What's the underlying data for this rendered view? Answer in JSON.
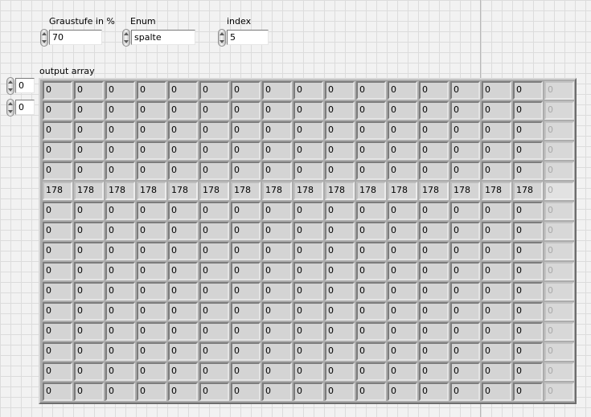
{
  "controls": {
    "graustufe": {
      "label": "Graustufe in %",
      "value": "70"
    },
    "enum": {
      "label": "Enum",
      "value": "spalte"
    },
    "index": {
      "label": "index",
      "value": "5"
    }
  },
  "output_array": {
    "label": "output array",
    "row_index": "0",
    "col_index": "0",
    "active_columns": 16,
    "columns_shown": 17,
    "highlight_row": 5,
    "rows": [
      [
        "0",
        "0",
        "0",
        "0",
        "0",
        "0",
        "0",
        "0",
        "0",
        "0",
        "0",
        "0",
        "0",
        "0",
        "0",
        "0",
        "0"
      ],
      [
        "0",
        "0",
        "0",
        "0",
        "0",
        "0",
        "0",
        "0",
        "0",
        "0",
        "0",
        "0",
        "0",
        "0",
        "0",
        "0",
        "0"
      ],
      [
        "0",
        "0",
        "0",
        "0",
        "0",
        "0",
        "0",
        "0",
        "0",
        "0",
        "0",
        "0",
        "0",
        "0",
        "0",
        "0",
        "0"
      ],
      [
        "0",
        "0",
        "0",
        "0",
        "0",
        "0",
        "0",
        "0",
        "0",
        "0",
        "0",
        "0",
        "0",
        "0",
        "0",
        "0",
        "0"
      ],
      [
        "0",
        "0",
        "0",
        "0",
        "0",
        "0",
        "0",
        "0",
        "0",
        "0",
        "0",
        "0",
        "0",
        "0",
        "0",
        "0",
        "0"
      ],
      [
        "178",
        "178",
        "178",
        "178",
        "178",
        "178",
        "178",
        "178",
        "178",
        "178",
        "178",
        "178",
        "178",
        "178",
        "178",
        "178",
        "0"
      ],
      [
        "0",
        "0",
        "0",
        "0",
        "0",
        "0",
        "0",
        "0",
        "0",
        "0",
        "0",
        "0",
        "0",
        "0",
        "0",
        "0",
        "0"
      ],
      [
        "0",
        "0",
        "0",
        "0",
        "0",
        "0",
        "0",
        "0",
        "0",
        "0",
        "0",
        "0",
        "0",
        "0",
        "0",
        "0",
        "0"
      ],
      [
        "0",
        "0",
        "0",
        "0",
        "0",
        "0",
        "0",
        "0",
        "0",
        "0",
        "0",
        "0",
        "0",
        "0",
        "0",
        "0",
        "0"
      ],
      [
        "0",
        "0",
        "0",
        "0",
        "0",
        "0",
        "0",
        "0",
        "0",
        "0",
        "0",
        "0",
        "0",
        "0",
        "0",
        "0",
        "0"
      ],
      [
        "0",
        "0",
        "0",
        "0",
        "0",
        "0",
        "0",
        "0",
        "0",
        "0",
        "0",
        "0",
        "0",
        "0",
        "0",
        "0",
        "0"
      ],
      [
        "0",
        "0",
        "0",
        "0",
        "0",
        "0",
        "0",
        "0",
        "0",
        "0",
        "0",
        "0",
        "0",
        "0",
        "0",
        "0",
        "0"
      ],
      [
        "0",
        "0",
        "0",
        "0",
        "0",
        "0",
        "0",
        "0",
        "0",
        "0",
        "0",
        "0",
        "0",
        "0",
        "0",
        "0",
        "0"
      ],
      [
        "0",
        "0",
        "0",
        "0",
        "0",
        "0",
        "0",
        "0",
        "0",
        "0",
        "0",
        "0",
        "0",
        "0",
        "0",
        "0",
        "0"
      ],
      [
        "0",
        "0",
        "0",
        "0",
        "0",
        "0",
        "0",
        "0",
        "0",
        "0",
        "0",
        "0",
        "0",
        "0",
        "0",
        "0",
        "0"
      ],
      [
        "0",
        "0",
        "0",
        "0",
        "0",
        "0",
        "0",
        "0",
        "0",
        "0",
        "0",
        "0",
        "0",
        "0",
        "0",
        "0",
        "0"
      ]
    ]
  },
  "icons": {
    "spinner": "increment-decrement-arrows-icon"
  },
  "colors": {
    "panel_background": "#f2f2f2",
    "grid_line": "#dcdcdc",
    "array_frame": "#acacac",
    "cell_background": "#d4d4d4",
    "disabled_text": "#a8a8a8"
  }
}
